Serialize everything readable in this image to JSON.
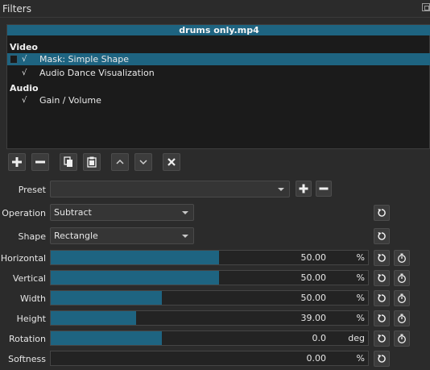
{
  "panel": {
    "title": "Filters",
    "float_icon": "float-icon"
  },
  "clip_name": "drums only.mp4",
  "groups": [
    {
      "label": "Video",
      "items": [
        {
          "label": "Mask: Simple Shape",
          "check": "√",
          "selected": true
        },
        {
          "label": "Audio Dance Visualization",
          "check": "√",
          "selected": false
        }
      ]
    },
    {
      "label": "Audio",
      "items": [
        {
          "label": "Gain / Volume",
          "check": "√",
          "selected": false
        }
      ]
    }
  ],
  "toolbar": {
    "buttons": [
      "add-icon",
      "remove-icon",
      "copy-icon",
      "paste-icon",
      "move-up-icon",
      "move-down-icon",
      "deselect-icon"
    ]
  },
  "preset": {
    "label": "Preset",
    "value": ""
  },
  "operation": {
    "label": "Operation",
    "value": "Subtract"
  },
  "shape": {
    "label": "Shape",
    "value": "Rectangle"
  },
  "params": [
    {
      "label": "Horizontal",
      "value": "50.00",
      "unit": "%",
      "level": 0.53,
      "keyframe": true
    },
    {
      "label": "Vertical",
      "value": "50.00",
      "unit": "%",
      "level": 0.53,
      "keyframe": true
    },
    {
      "label": "Width",
      "value": "50.00",
      "unit": "%",
      "level": 0.35,
      "keyframe": true
    },
    {
      "label": "Height",
      "value": "39.00",
      "unit": "%",
      "level": 0.27,
      "keyframe": true
    },
    {
      "label": "Rotation",
      "value": "0.0",
      "unit": "deg",
      "level": 0.35,
      "keyframe": true
    },
    {
      "label": "Softness",
      "value": "0.00",
      "unit": "%",
      "level": 0.0,
      "keyframe": false
    }
  ],
  "colors": {
    "accent": "#1e6481",
    "background": "#2b2b2b"
  }
}
